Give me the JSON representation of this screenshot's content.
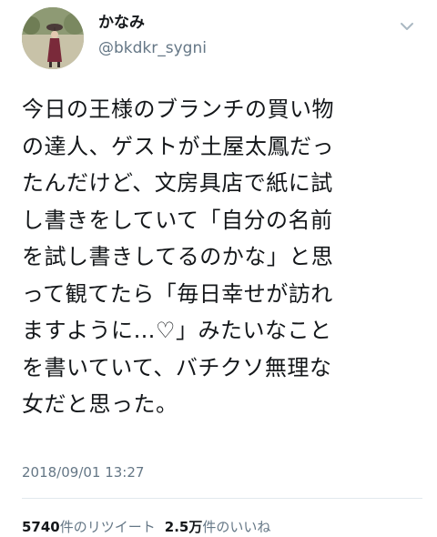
{
  "user": {
    "display_name": "かなみ",
    "handle": "@bkdkr_sygni",
    "avatar_icon": "user-avatar-photo"
  },
  "tweet": {
    "lines": [
      "今日の王様のブランチの買い物",
      "の達人、ゲストが土屋太鳳だっ",
      "たんだけど、文房具店で紙に試",
      "し書きをしていて「自分の名前",
      "を試し書きしてるのかな」と思",
      "って観てたら「毎日幸せが訪れ",
      "ますように…♡」みたいなこと",
      "を書いていて、バチクソ無理な",
      "女だと思った。"
    ],
    "timestamp": "2018/09/01 13:27"
  },
  "stats": {
    "retweet_count": "5740",
    "retweet_label": "件のリツイート",
    "like_count": "2.5万",
    "like_label": "件のいいね"
  },
  "icons": {
    "menu": "chevron-down-icon"
  },
  "colors": {
    "text": "#14171a",
    "secondary": "#657786",
    "divider": "#e1e8ed"
  }
}
